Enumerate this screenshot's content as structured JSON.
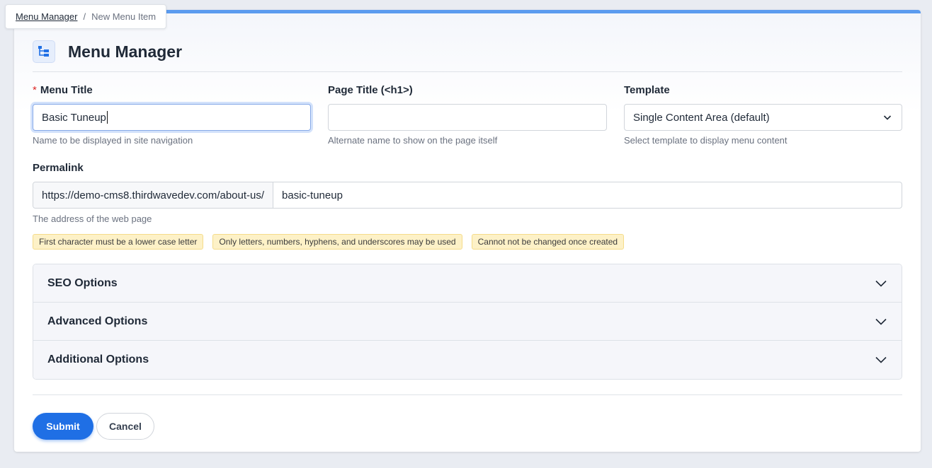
{
  "breadcrumb": {
    "parent": "Menu Manager",
    "separator": "/",
    "current": "New Menu Item"
  },
  "header": {
    "title": "Menu Manager",
    "icon": "menu-tree-icon"
  },
  "fields": {
    "menu_title": {
      "label": "Menu Title",
      "required_mark": "*",
      "value": "Basic Tuneup",
      "help": "Name to be displayed in site navigation"
    },
    "page_title": {
      "label": "Page Title (<h1>)",
      "value": "",
      "help": "Alternate name to show on the page itself"
    },
    "template": {
      "label": "Template",
      "value": "Single Content Area (default)",
      "help": "Select template to display menu content"
    },
    "permalink": {
      "label": "Permalink",
      "prefix": "https://demo-cms8.thirdwavedev.com/about-us/",
      "value": "basic-tuneup",
      "help": "The address of the web page"
    }
  },
  "badges": [
    "First character must be a lower case letter",
    "Only letters, numbers, hyphens, and underscores may be used",
    "Cannot not be changed once created"
  ],
  "accordion": [
    {
      "label": "SEO Options"
    },
    {
      "label": "Advanced Options"
    },
    {
      "label": "Additional Options"
    }
  ],
  "buttons": {
    "submit": "Submit",
    "cancel": "Cancel"
  },
  "colors": {
    "accent": "#1f6fe5",
    "top_border": "#5b9bef",
    "required": "#dc2626",
    "badge_bg": "#fdf1c7"
  }
}
